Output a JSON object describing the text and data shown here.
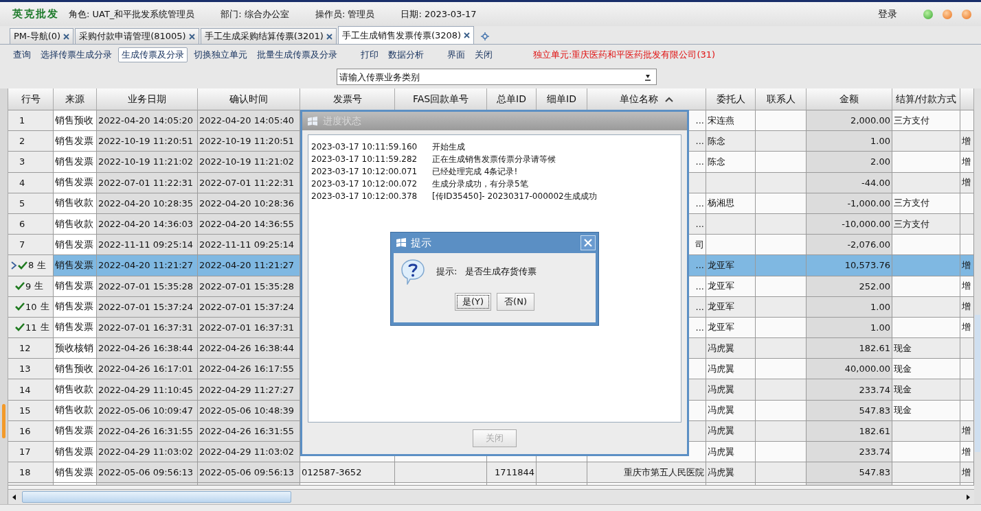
{
  "header": {
    "logo": "英克批发",
    "info": [
      "角色: UAT_和平批发系统管理员",
      "部门: 综合办公室",
      "操作员: 管理员",
      "日期: 2023-03-17"
    ],
    "login": "登录"
  },
  "tabs": [
    {
      "label": "PM-导航(0)",
      "selected": false
    },
    {
      "label": "采购付款申请管理(81005)",
      "selected": false
    },
    {
      "label": "手工生成采购结算传票(3201)",
      "selected": false
    },
    {
      "label": "手工生成销售发票传票(3208)",
      "selected": true
    }
  ],
  "toolbar": {
    "groups": [
      [
        {
          "label": "查询",
          "selected": false
        },
        {
          "label": "选择传票生成分录",
          "selected": false
        },
        {
          "label": "生成传票及分录",
          "selected": true
        },
        {
          "label": "切换独立单元",
          "selected": false
        },
        {
          "label": "批量生成传票及分录",
          "selected": false
        }
      ],
      [
        {
          "label": "打印",
          "selected": false
        },
        {
          "label": "数据分析",
          "selected": false
        }
      ],
      [
        {
          "label": "界面",
          "selected": false
        },
        {
          "label": "关闭",
          "selected": false
        }
      ]
    ],
    "unit": "独立单元:重庆医药和平医药批发有限公司(31)"
  },
  "category_field": {
    "placeholder": "请输入传票业务类别"
  },
  "table": {
    "columns": [
      "行号",
      "来源",
      "业务日期",
      "确认时间",
      "发票号",
      "FAS回款单号",
      "总单ID",
      "细单ID",
      "单位名称",
      "委托人",
      "联系人",
      "金额",
      "结算/付款方式"
    ],
    "rows": [
      {
        "no": "1",
        "source": "销售预收",
        "business_date": "2022-04-20 14:05:20",
        "confirm_time": "2022-04-20 14:05:40",
        "unit_name": "...",
        "consignor": "宋连燕",
        "amount": "2,000.00",
        "settlement": "三方支付",
        "selected": false,
        "current": false,
        "generated": false
      },
      {
        "no": "2",
        "source": "销售发票",
        "business_date": "2022-10-19 11:20:51",
        "confirm_time": "2022-10-19 11:20:51",
        "unit_name": "...",
        "consignor": "陈念",
        "amount": "1.00",
        "column_14": "增",
        "selected": false,
        "current": false,
        "generated": false
      },
      {
        "no": "3",
        "source": "销售发票",
        "business_date": "2022-10-19 11:21:02",
        "confirm_time": "2022-10-19 11:21:02",
        "unit_name": "...",
        "consignor": "陈念",
        "amount": "2.00",
        "column_14": "增",
        "selected": false,
        "current": false,
        "generated": false
      },
      {
        "no": "4",
        "source": "销售发票",
        "business_date": "2022-07-01 11:22:31",
        "confirm_time": "2022-07-01 11:22:31",
        "amount": "-44.00",
        "column_14": "增",
        "selected": false,
        "current": false,
        "generated": false
      },
      {
        "no": "5",
        "source": "销售收款",
        "business_date": "2022-04-20 10:28:35",
        "confirm_time": "2022-04-20 10:28:36",
        "unit_name": "...",
        "consignor": "杨湘思",
        "amount": "-1,000.00",
        "settlement": "三方支付",
        "selected": false,
        "current": false,
        "generated": false
      },
      {
        "no": "6",
        "source": "销售收款",
        "business_date": "2022-04-20 14:36:03",
        "confirm_time": "2022-04-20 14:36:55",
        "unit_name": "...",
        "amount": "-10,000.00",
        "settlement": "三方支付",
        "selected": false,
        "current": false,
        "generated": false
      },
      {
        "no": "7",
        "source": "销售发票",
        "business_date": "2022-11-11 09:25:14",
        "confirm_time": "2022-11-11 09:25:14",
        "unit_name": "司",
        "amount": "-2,076.00",
        "selected": false,
        "current": false,
        "generated": false
      },
      {
        "no": "8",
        "status": "生",
        "source": "销售发票",
        "business_date": "2022-04-20 11:21:27",
        "confirm_time": "2022-04-20 11:21:27",
        "unit_name": "...",
        "consignor": "龙亚军",
        "amount": "10,573.76",
        "column_14": "增",
        "selected": true,
        "current": true,
        "generated": true
      },
      {
        "no": "9",
        "status": "生",
        "source": "销售发票",
        "business_date": "2022-07-01 15:35:28",
        "confirm_time": "2022-07-01 15:35:28",
        "unit_name": "...",
        "consignor": "龙亚军",
        "amount": "252.00",
        "column_14": "增",
        "selected": false,
        "current": false,
        "generated": true
      },
      {
        "no": "10",
        "status": "生",
        "source": "销售发票",
        "business_date": "2022-07-01 15:37:24",
        "confirm_time": "2022-07-01 15:37:24",
        "unit_name": "...",
        "consignor": "龙亚军",
        "amount": "1.00",
        "column_14": "增",
        "selected": false,
        "current": false,
        "generated": true
      },
      {
        "no": "11",
        "status": "生",
        "source": "销售发票",
        "business_date": "2022-07-01 16:37:31",
        "confirm_time": "2022-07-01 16:37:31",
        "unit_name": "...",
        "consignor": "龙亚军",
        "amount": "1.00",
        "column_14": "增",
        "selected": false,
        "current": false,
        "generated": true
      },
      {
        "no": "12",
        "source": "预收核销",
        "business_date": "2022-04-26 16:38:44",
        "confirm_time": "2022-04-26 16:38:44",
        "consignor": "冯虎翼",
        "amount": "182.61",
        "settlement": "现金",
        "selected": false,
        "current": false,
        "generated": false
      },
      {
        "no": "13",
        "source": "销售预收",
        "business_date": "2022-04-26 16:17:01",
        "confirm_time": "2022-04-26 16:17:55",
        "consignor": "冯虎翼",
        "amount": "40,000.00",
        "settlement": "现金",
        "selected": false,
        "current": false,
        "generated": false
      },
      {
        "no": "14",
        "source": "销售收款",
        "business_date": "2022-04-29 11:10:45",
        "confirm_time": "2022-04-29 11:27:27",
        "consignor": "冯虎翼",
        "amount": "233.74",
        "settlement": "现金",
        "selected": false,
        "current": false,
        "generated": false
      },
      {
        "no": "15",
        "source": "销售收款",
        "business_date": "2022-05-06 10:09:47",
        "confirm_time": "2022-05-06 10:48:39",
        "consignor": "冯虎翼",
        "amount": "547.83",
        "settlement": "现金",
        "selected": false,
        "current": false,
        "generated": false
      },
      {
        "no": "16",
        "source": "销售发票",
        "business_date": "2022-04-26 16:31:55",
        "confirm_time": "2022-04-26 16:31:55",
        "consignor": "冯虎翼",
        "amount": "182.61",
        "column_14": "增",
        "selected": false,
        "current": false,
        "generated": false
      },
      {
        "no": "17",
        "source": "销售发票",
        "business_date": "2022-04-29 11:03:02",
        "confirm_time": "2022-04-29 11:03:02",
        "consignor": "冯虎翼",
        "amount": "233.74",
        "column_14": "增",
        "selected": false,
        "current": false,
        "generated": false
      },
      {
        "no": "18",
        "source": "销售发票",
        "business_date": "2022-05-06 09:56:13",
        "confirm_time": "2022-05-06 09:56:13",
        "invoice_no": "012587-3652",
        "order_id": "1711844",
        "unit_name": "重庆市第五人民医院",
        "consignor": "冯虎翼",
        "amount": "547.83",
        "column_14": "增",
        "selected": false,
        "current": false,
        "generated": false
      }
    ]
  },
  "progress_dialog": {
    "title": "进度状态",
    "log": [
      {
        "time": "2023-03-17 10:11:59.160",
        "message": "开始生成"
      },
      {
        "time": "2023-03-17 10:11:59.282",
        "message": "正在生成销售发票传票分录请等候"
      },
      {
        "time": "2023-03-17 10:12:00.071",
        "message": "已经处理完成 4条记录!"
      },
      {
        "time": "2023-03-17 10:12:00.072",
        "message": "生成分录成功，有分录5笔"
      },
      {
        "time": "2023-03-17 10:12:00.378",
        "message": "[传ID35450]- 20230317-000002生成成功"
      }
    ],
    "close_button": {
      "label": "关闭",
      "disabled": true
    }
  },
  "prompt_dialog": {
    "title": "提示",
    "label": "提示:",
    "message": "是否生成存货传票",
    "buttons": [
      {
        "label": "是(Y)",
        "focused": true
      },
      {
        "label": "否(N)",
        "focused": false
      }
    ]
  }
}
